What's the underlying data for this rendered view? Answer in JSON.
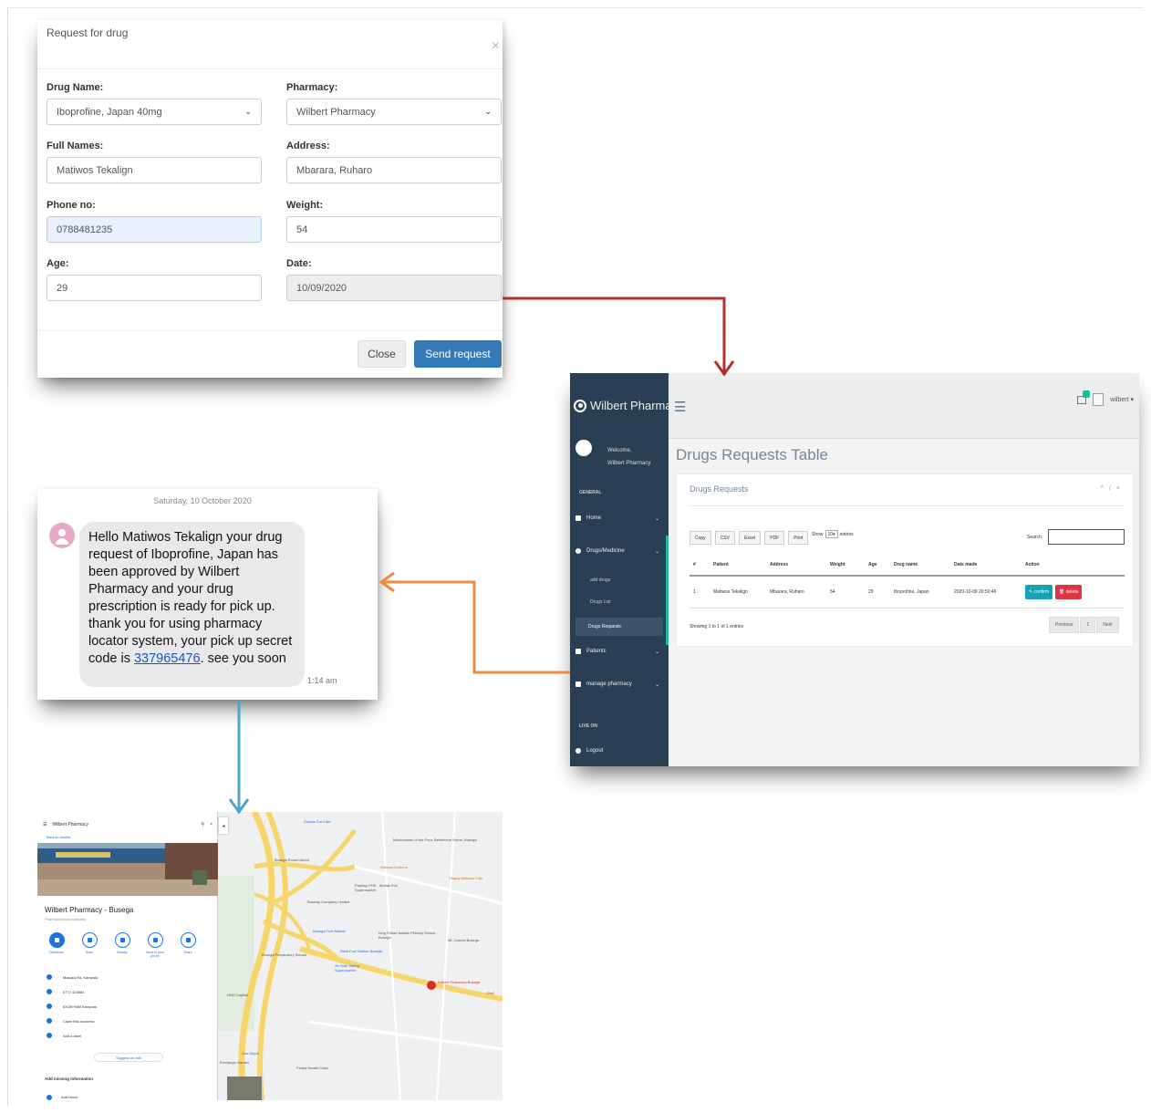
{
  "modal": {
    "title": "Request for drug",
    "close_symbol": "×",
    "fields": {
      "drug_name": {
        "label": "Drug Name:",
        "value": "Iboprofine, Japan 40mg"
      },
      "pharmacy": {
        "label": "Pharmacy:",
        "value": "Wilbert Pharmacy"
      },
      "full_names": {
        "label": "Full Names:",
        "value": "Matiwos Tekalign"
      },
      "address": {
        "label": "Address:",
        "value": "Mbarara, Ruharo"
      },
      "phone": {
        "label": "Phone no:",
        "value": "0788481235"
      },
      "weight": {
        "label": "Weight:",
        "value": "54"
      },
      "age": {
        "label": "Age:",
        "value": "29"
      },
      "date": {
        "label": "Date:",
        "value": "10/09/2020"
      }
    },
    "buttons": {
      "close": "Close",
      "send": "Send request"
    }
  },
  "dashboard": {
    "brand": "Wilbert Pharmacy",
    "welcome_line1": "Welcome,",
    "welcome_line2": "Wilbert Pharmacy",
    "section_general": "GENERAL",
    "nav": {
      "home": "Home",
      "drugs": "Drugs/Medicine",
      "add_drugs": "add drugs",
      "drugs_list": "Drugs List",
      "drug_requests": "Drugs Requests",
      "patients": "Patients",
      "manage": "manage pharmacy",
      "logout": "Logout"
    },
    "section_live": "LIVE ON",
    "user": "wilbert",
    "page_title": "Drugs Requests Table",
    "panel_title": "Drugs Requests",
    "panel_tools": "^ / ×",
    "exports": [
      "Copy",
      "CSV",
      "Excel",
      "PDF",
      "Print"
    ],
    "show_label": "Show",
    "show_value": "10",
    "entries_label": "entries",
    "search_label": "Search:",
    "columns": [
      "#",
      "Patient",
      "Address",
      "Weight",
      "Age",
      "Drug name",
      "Date made",
      "Action"
    ],
    "rows": [
      {
        "num": "1",
        "patient": "Matiwos Tekalign",
        "address": "Mbarara, Ruharo",
        "weight": "54",
        "age": "29",
        "drug": "Iboprofine, Japan",
        "date": "2020-10-09 20:50:46",
        "confirm": "confirm",
        "delete": "delete"
      }
    ],
    "showing": "Showing 1 to 1 of 1 entries",
    "pager": {
      "prev": "Previous",
      "page": "1",
      "next": "Next"
    }
  },
  "sms": {
    "date": "Saturday, 10 October 2020",
    "message_before": "Hello Matiwos Tekalign your drug request of Iboprofine, Japan has been approved by Wilbert Pharmacy and your drug prescription is ready for pick up. thank you for using pharmacy locator system, your pick up secret code is ",
    "code": "337965476",
    "message_after": ". see you soon",
    "time": "1:14 am"
  },
  "map": {
    "search_value": "Wilbert Pharmacy",
    "back": "Back to results",
    "place_name": "Wilbert Pharmacy - Busega",
    "category": "Pharmaceutical company",
    "actions": [
      "Directions",
      "Save",
      "Nearby",
      "Send to your phone",
      "Share"
    ],
    "info": [
      "Masaka Rd, Kampala",
      "0772 423884",
      "8XGR+MM Kampala",
      "Claim this business",
      "Add a label"
    ],
    "suggest": "Suggest an edit",
    "missing": "Add missing information",
    "hours": "Add hours",
    "labels": {
      "l1": "Double Cut Cafe",
      "l2": "Missionaries of the Poor, Bethlehem Home, Busega",
      "l3": "Busega Round About",
      "l4": "Walima Gardens",
      "l5": "Happy Mukasa Cafe",
      "l6": "Payway PHS - Mutale Fun Supermarket",
      "l7": "Busway Company Limited",
      "l8": "Busega Fuel Market",
      "l9": "King Fahad Islamic Primary School - Busega",
      "l10": "Mt. Carmel Busega",
      "l11": "Shell Fuel Station Busega",
      "l12": "Busega Preparatory School",
      "l13": "Jin Wan Sheng Supermarket",
      "l14": "Wilbert Pharmacy Busega",
      "l15": "Shell",
      "l16": "UNO Capital",
      "l17": "Gaz Depot",
      "l18": "Exchange Garden",
      "l19": "Fedad Health Clinic"
    }
  },
  "colors": {
    "arrow_red": "#b5302d",
    "arrow_orange": "#ed8b43",
    "arrow_blue": "#4da6c8",
    "sidebar": "#2a3f54",
    "primary": "#337ab7"
  }
}
